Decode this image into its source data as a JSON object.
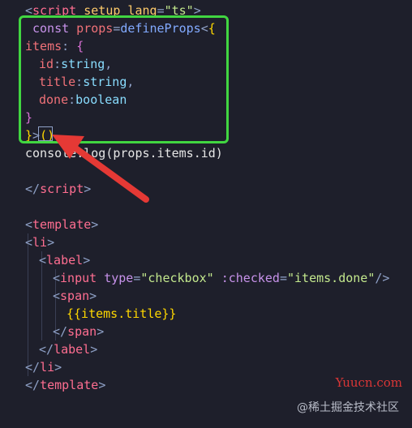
{
  "code": {
    "line1": {
      "lt": "<",
      "tag": "script",
      "attr": " setup lang",
      "eq": "=",
      "val": "\"ts\"",
      "gt": ">"
    },
    "line2": {
      "kw": "const",
      "ident": " props",
      "eq": "=",
      "func": "defineProps",
      "lt": "<",
      "brace": "{"
    },
    "line3": {
      "name": "items",
      "colon": ": ",
      "brace": "{"
    },
    "line4": {
      "name": "id",
      "colon": ":",
      "type": "string",
      "comma": ","
    },
    "line5": {
      "name": "title",
      "colon": ":",
      "type": "string",
      "comma": ","
    },
    "line6": {
      "name": "done",
      "colon": ":",
      "type": "boolean"
    },
    "line7": {
      "brace": "}"
    },
    "line8": {
      "brace": "}",
      "gt": ">",
      "parens": "()"
    },
    "line9": {
      "text": "console.log(props.items.id)"
    },
    "line11": {
      "open": "</",
      "tag": "script",
      "close": ">"
    },
    "line13": {
      "open": "<",
      "tag": "template",
      "close": ">"
    },
    "line14": {
      "open": "<",
      "tag": "li",
      "close": ">"
    },
    "line15": {
      "open": "<",
      "tag": "label",
      "close": ">"
    },
    "line16": {
      "open": "<",
      "tag": "input",
      "attr1": " type",
      "eq1": "=",
      "val1": "\"checkbox\"",
      "attr2": " :checked",
      "eq2": "=",
      "val2": "\"items.done\"",
      "close": "/>"
    },
    "line17": {
      "open": "<",
      "tag": "span",
      "close": ">"
    },
    "line18": {
      "text": "{{items.title}}"
    },
    "line19": {
      "open": "</",
      "tag": "span",
      "close": ">"
    },
    "line20": {
      "open": "</",
      "tag": "label",
      "close": ">"
    },
    "line21": {
      "open": "</",
      "tag": "li",
      "close": ">"
    },
    "line22": {
      "open": "</",
      "tag": "template",
      "close": ">"
    }
  },
  "watermark": {
    "site": "Yuucn.com",
    "source": "@稀土掘金技术社区"
  },
  "colors": {
    "highlight": "#41d641",
    "arrow": "#e53935",
    "background": "#1e1f2b"
  }
}
